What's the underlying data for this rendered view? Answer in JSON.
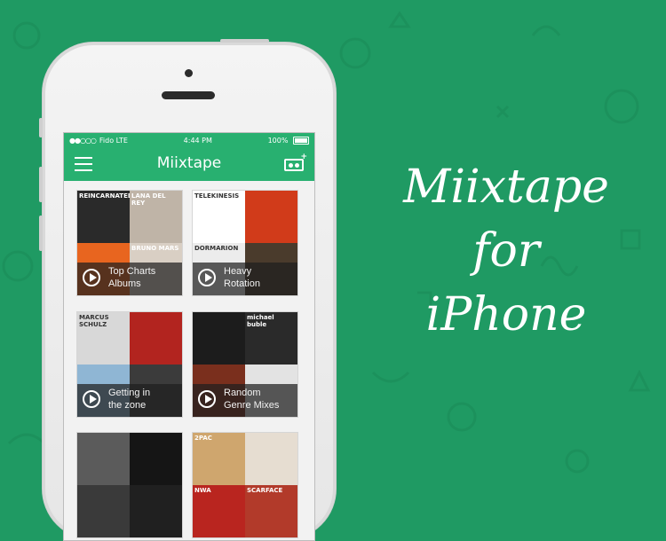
{
  "status_bar": {
    "carrier": "Fido LTE",
    "time": "4:44 PM",
    "battery": "100%"
  },
  "nav": {
    "title": "Miixtape"
  },
  "cards": [
    {
      "line1": "Top Charts",
      "line2": "Albums",
      "tiles": [
        {
          "color": "#2a2a2a",
          "text": "REINCARNATED"
        },
        {
          "color": "#bfb4a7",
          "text": "LANA DEL REY"
        },
        {
          "color": "#e8651f",
          "text": ""
        },
        {
          "color": "#d9cfc4",
          "text": "BRUNO MARS"
        }
      ]
    },
    {
      "line1": "Heavy",
      "line2": "Rotation",
      "tiles": [
        {
          "color": "#ffffff",
          "text": "TELEKINESIS"
        },
        {
          "color": "#d13b1a",
          "text": ""
        },
        {
          "color": "#ececec",
          "text": "DORMARION"
        },
        {
          "color": "#4a3b2c",
          "text": ""
        }
      ]
    },
    {
      "line1": "Getting in",
      "line2": "the zone",
      "tiles": [
        {
          "color": "#d8d8d8",
          "text": "MARCUS SCHULZ"
        },
        {
          "color": "#b2241f",
          "text": ""
        },
        {
          "color": "#8fb6d4",
          "text": ""
        },
        {
          "color": "#3b3b3b",
          "text": ""
        }
      ]
    },
    {
      "line1": "Random",
      "line2": "Genre Mixes",
      "tiles": [
        {
          "color": "#1c1c1c",
          "text": ""
        },
        {
          "color": "#2a2a2a",
          "text": "michael buble"
        },
        {
          "color": "#7a2f1d",
          "text": ""
        },
        {
          "color": "#e3e3e3",
          "text": ""
        }
      ]
    },
    {
      "line1": "",
      "line2": "",
      "tiles": [
        {
          "color": "#5b5b5b",
          "text": ""
        },
        {
          "color": "#151515",
          "text": ""
        },
        {
          "color": "#3a3a3a",
          "text": ""
        },
        {
          "color": "#202020",
          "text": ""
        }
      ]
    },
    {
      "line1": "",
      "line2": "",
      "tiles": [
        {
          "color": "#cfa66e",
          "text": "2PAC"
        },
        {
          "color": "#e6ddd1",
          "text": ""
        },
        {
          "color": "#b9251f",
          "text": "NWA"
        },
        {
          "color": "#b23a2a",
          "text": "SCARFACE"
        }
      ]
    }
  ],
  "headline": {
    "line1": "Miixtape",
    "line2": "for",
    "line3": "iPhone"
  },
  "colors": {
    "background": "#1f9a63",
    "app_green": "#28b070"
  }
}
